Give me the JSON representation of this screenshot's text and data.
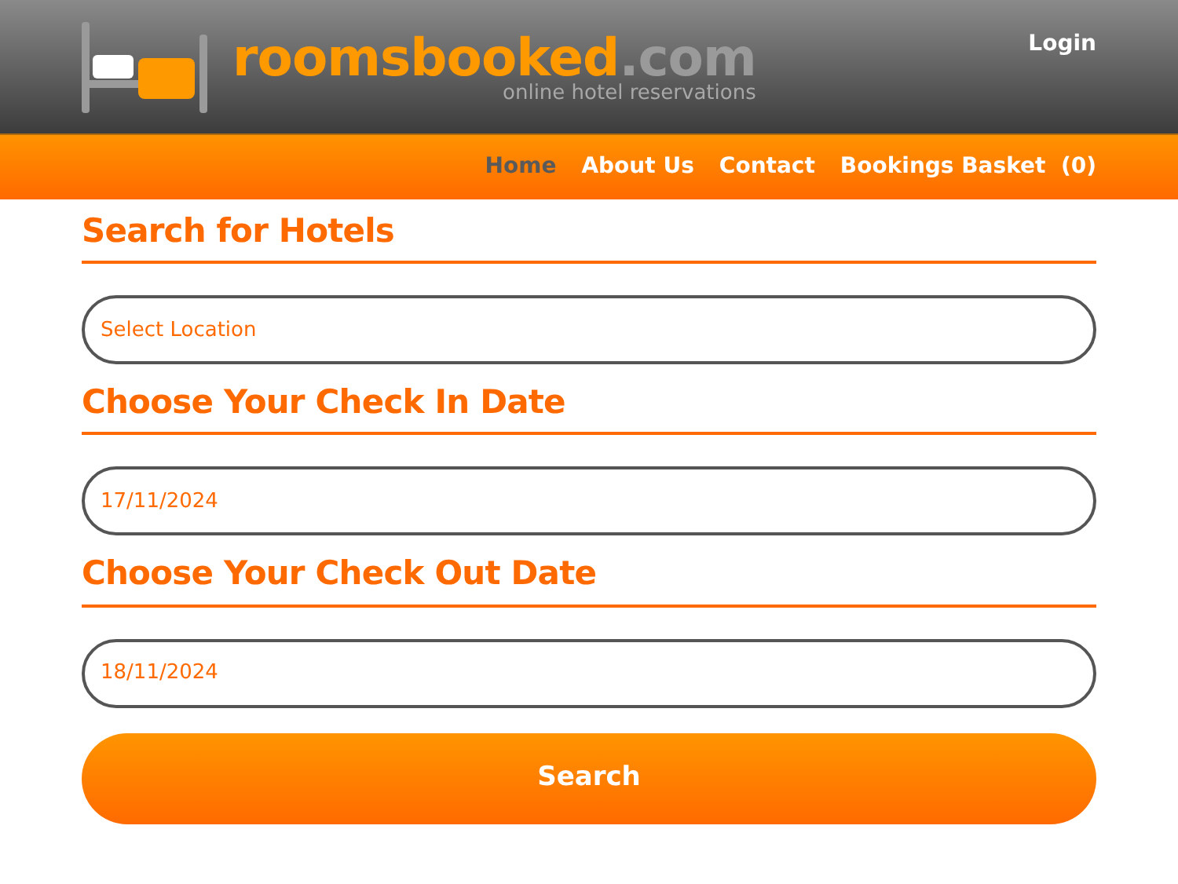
{
  "header": {
    "logo": {
      "name": "roomsbooked",
      "suffix": ".com",
      "tagline": "online hotel reservations"
    },
    "login": "Login"
  },
  "nav": [
    {
      "label": "Home",
      "selected": true
    },
    {
      "label": "About Us",
      "selected": false
    },
    {
      "label": "Contact",
      "selected": false
    },
    {
      "label": "Bookings Basket  (0)",
      "selected": false
    }
  ],
  "form": [
    {
      "heading": "Search for Hotels",
      "value": "Select Location"
    },
    {
      "heading": "Choose Your Check In Date",
      "value": "17/11/2024"
    },
    {
      "heading": "Choose Your Check Out Date",
      "value": "18/11/2024"
    }
  ],
  "search_button": "Search"
}
